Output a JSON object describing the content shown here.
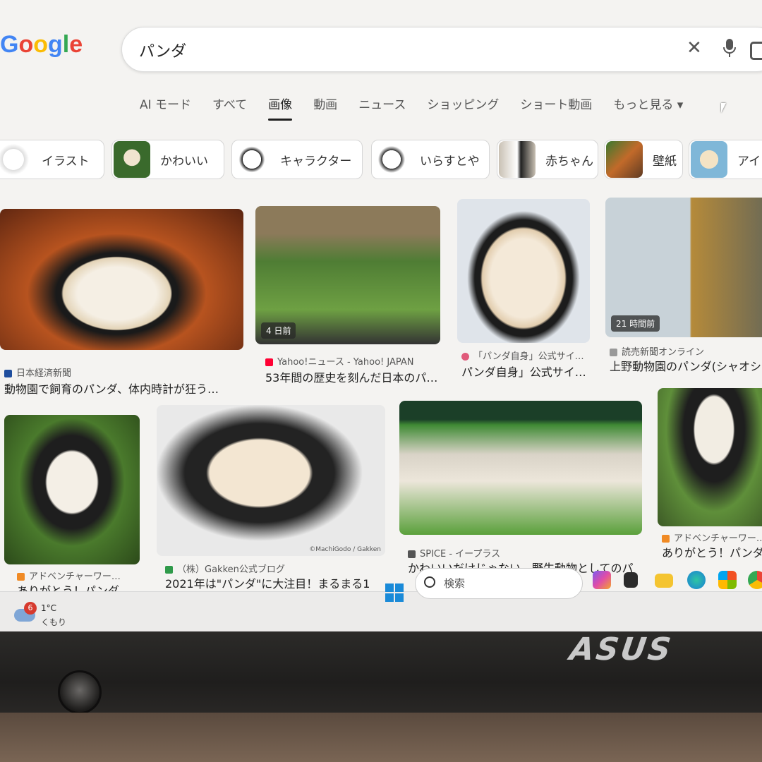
{
  "search": {
    "query": "パンダ"
  },
  "logo": {
    "text": "Google"
  },
  "tabs": [
    "AI モード",
    "すべて",
    "画像",
    "動画",
    "ニュース",
    "ショッピング",
    "ショート動画",
    "もっと見る ▾"
  ],
  "active_tab": "画像",
  "chips": [
    "イラスト",
    "かわいい",
    "キャラクター",
    "いらすとや",
    "赤ちゃん",
    "壁紙",
    "アイコ"
  ],
  "results": [
    {
      "source": "日本経済新聞",
      "caption": "動物園で飼育のパンダ、体内時計が狂う…",
      "badge": ""
    },
    {
      "source": "Yahoo!ニュース - Yahoo! JAPAN",
      "caption": "53年間の歴史を刻んだ日本のパ…",
      "badge": "4 日前"
    },
    {
      "source": "「パンダ自身」公式サイ…",
      "caption": "パンダ自身」公式サイ…",
      "badge": ""
    },
    {
      "source": "読売新聞オンライン",
      "caption": "上野動物園のパンダ(シャオシ…",
      "badge": "21 時間前"
    },
    {
      "source": "アドベンチャーワー…",
      "caption": "ありがとう！パンダ",
      "badge": ""
    },
    {
      "source": "（株）Gakken公式ブログ",
      "caption": "2021年は\"パンダ\"に大注目！まるまる1",
      "badge": ""
    },
    {
      "source": "SPICE - イープラス",
      "caption": "かわいいだけじゃない、野生動物としてのパ",
      "badge": ""
    },
    {
      "source": "アドベンチャーワー…",
      "caption": "ありがとう！パンダ",
      "badge": ""
    }
  ],
  "watermark": "©MachiGodo / Gakken",
  "taskbar": {
    "search_placeholder": "検索",
    "weather_badge": "6",
    "temperature": "1°C",
    "condition": "くもり"
  },
  "brand": "ASUS",
  "colors": {
    "active_tab_underline": "#1f1f1f",
    "start_blue": "#1a8ad8"
  }
}
